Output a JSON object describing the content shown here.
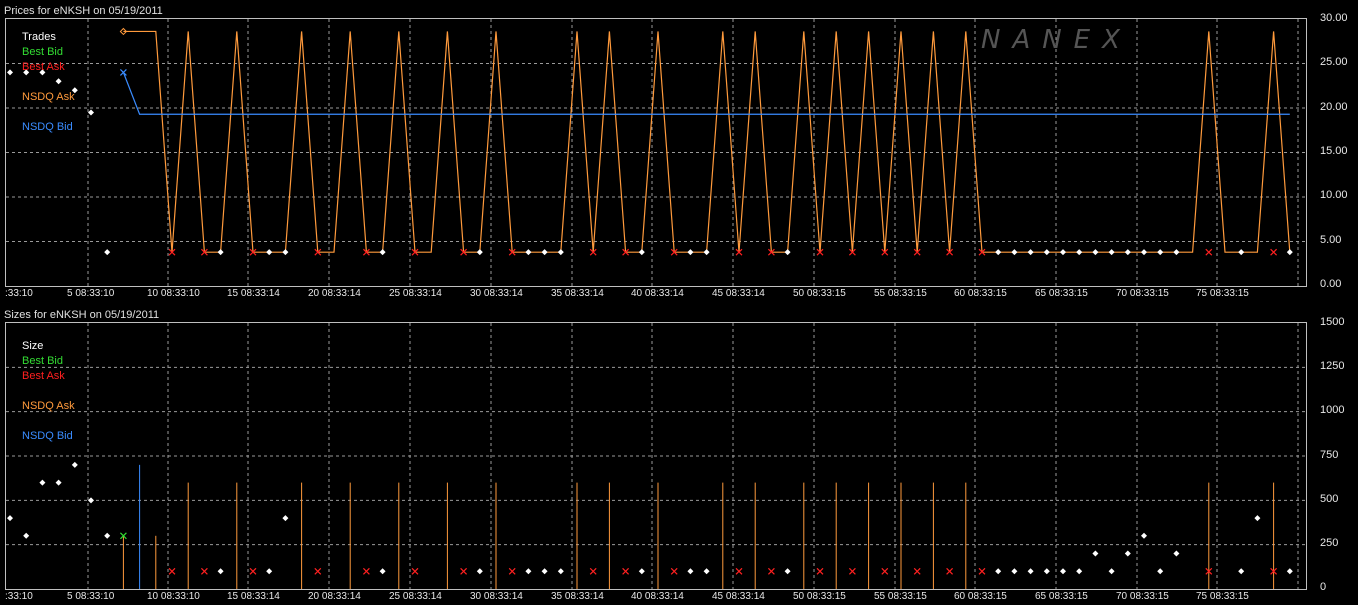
{
  "price_panel": {
    "title": "Prices for  eNKSH  on  05/19/2011",
    "watermark": "NANEX",
    "legend": [
      {
        "label": "Trades",
        "color": "#ffffff"
      },
      {
        "label": "Best Bid",
        "color": "#33dd33"
      },
      {
        "label": "Best Ask",
        "color": "#ff2020"
      },
      {
        "label": "NSDQ Ask",
        "color": "#ff9a3c"
      },
      {
        "label": "NSDQ Bid",
        "color": "#3a8cff"
      }
    ],
    "y_tick_labels": [
      "30.00",
      "25.00",
      "20.00",
      "15.00",
      "10.00",
      "5.00",
      "0.00"
    ]
  },
  "size_panel": {
    "title": "Sizes for  eNKSH  on  05/19/2011",
    "legend": [
      {
        "label": "Size",
        "color": "#ffffff"
      },
      {
        "label": "Best Bid",
        "color": "#33dd33"
      },
      {
        "label": "Best Ask",
        "color": "#ff2020"
      },
      {
        "label": "NSDQ Ask",
        "color": "#ff9a3c"
      },
      {
        "label": "NSDQ Bid",
        "color": "#3a8cff"
      }
    ],
    "y_tick_labels": [
      "1500",
      "1250",
      "1000",
      "750",
      "500",
      "250",
      "0"
    ]
  },
  "x_tick_labels": [
    ":33:10",
    "5 08:33:10",
    "10 08:33:10",
    "15 08:33:14",
    "20 08:33:14",
    "25 08:33:14",
    "30 08:33:14",
    "35 08:33:14",
    "40 08:33:14",
    "45 08:33:14",
    "50 08:33:15",
    "55 08:33:15",
    "60 08:33:15",
    "65 08:33:15",
    "70 08:33:15",
    "75 08:33:15"
  ],
  "chart_data": [
    {
      "type": "line",
      "title": "Prices for  eNKSH  on  05/19/2011",
      "ylim": [
        0,
        30
      ],
      "xlim": [
        0,
        80.5
      ],
      "grid": true,
      "legend_position": "top-left",
      "trades": [
        [
          0,
          24.0
        ],
        [
          1,
          24.0
        ],
        [
          2,
          24.0
        ],
        [
          3,
          23.0
        ],
        [
          4,
          22.0
        ],
        [
          5,
          19.5
        ],
        [
          6,
          3.8
        ],
        [
          13,
          3.8
        ],
        [
          16,
          3.8
        ],
        [
          17,
          3.8
        ],
        [
          23,
          3.8
        ],
        [
          29,
          3.8
        ],
        [
          32,
          3.8
        ],
        [
          33,
          3.8
        ],
        [
          34,
          3.8
        ],
        [
          39,
          3.8
        ],
        [
          42,
          3.8
        ],
        [
          43,
          3.8
        ],
        [
          48,
          3.8
        ],
        [
          61,
          3.8
        ],
        [
          62,
          3.8
        ],
        [
          63,
          3.8
        ],
        [
          64,
          3.8
        ],
        [
          65,
          3.8
        ],
        [
          66,
          3.8
        ],
        [
          67,
          3.8
        ],
        [
          68,
          3.8
        ],
        [
          69,
          3.8
        ],
        [
          70,
          3.8
        ],
        [
          71,
          3.8
        ],
        [
          72,
          3.8
        ],
        [
          76,
          3.8
        ],
        [
          79,
          3.8
        ]
      ],
      "best_ask_points": [
        [
          10,
          3.8
        ],
        [
          12,
          3.8
        ],
        [
          15,
          3.8
        ],
        [
          19,
          3.8
        ],
        [
          22,
          3.8
        ],
        [
          25,
          3.8
        ],
        [
          28,
          3.8
        ],
        [
          31,
          3.8
        ],
        [
          36,
          3.8
        ],
        [
          38,
          3.8
        ],
        [
          41,
          3.8
        ],
        [
          45,
          3.8
        ],
        [
          47,
          3.8
        ],
        [
          50,
          3.8
        ],
        [
          52,
          3.8
        ],
        [
          54,
          3.8
        ],
        [
          56,
          3.8
        ],
        [
          58,
          3.8
        ],
        [
          60,
          3.8
        ],
        [
          74,
          3.8
        ],
        [
          78,
          3.8
        ]
      ],
      "nsdq_ask": [
        [
          7,
          28.6
        ],
        [
          9,
          28.6
        ],
        [
          10,
          3.8
        ],
        [
          11,
          28.6
        ],
        [
          12,
          3.8
        ],
        [
          13,
          3.8
        ],
        [
          14,
          28.6
        ],
        [
          15,
          3.8
        ],
        [
          17,
          3.8
        ],
        [
          18,
          28.6
        ],
        [
          19,
          3.8
        ],
        [
          20,
          3.8
        ],
        [
          21,
          28.6
        ],
        [
          22,
          3.8
        ],
        [
          23,
          3.8
        ],
        [
          24,
          28.6
        ],
        [
          25,
          3.8
        ],
        [
          26,
          3.8
        ],
        [
          27,
          28.6
        ],
        [
          28,
          3.8
        ],
        [
          29,
          3.8
        ],
        [
          30,
          28.6
        ],
        [
          31,
          3.8
        ],
        [
          34,
          3.8
        ],
        [
          35,
          28.6
        ],
        [
          36,
          3.8
        ],
        [
          37,
          28.6
        ],
        [
          38,
          3.8
        ],
        [
          39,
          3.8
        ],
        [
          40,
          28.6
        ],
        [
          41,
          3.8
        ],
        [
          43,
          3.8
        ],
        [
          44,
          28.6
        ],
        [
          45,
          3.8
        ],
        [
          46,
          28.6
        ],
        [
          47,
          3.8
        ],
        [
          48,
          3.8
        ],
        [
          49,
          28.6
        ],
        [
          50,
          3.8
        ],
        [
          51,
          28.6
        ],
        [
          52,
          3.8
        ],
        [
          53,
          28.6
        ],
        [
          54,
          3.8
        ],
        [
          55,
          28.6
        ],
        [
          56,
          3.8
        ],
        [
          57,
          28.6
        ],
        [
          58,
          3.8
        ],
        [
          59,
          28.6
        ],
        [
          60,
          3.8
        ],
        [
          73,
          3.8
        ],
        [
          74,
          28.6
        ],
        [
          75,
          3.8
        ],
        [
          77,
          3.8
        ],
        [
          78,
          28.6
        ],
        [
          79,
          3.8
        ]
      ],
      "nsdq_bid": [
        [
          7,
          24.0
        ],
        [
          8,
          19.3
        ],
        [
          79,
          19.3
        ]
      ],
      "best_bid_points": []
    },
    {
      "type": "bar",
      "title": "Sizes for  eNKSH  on  05/19/2011",
      "ylim": [
        0,
        1500
      ],
      "xlim": [
        0,
        80.5
      ],
      "grid": true,
      "legend_position": "top-left",
      "trade_sizes": [
        [
          0,
          400
        ],
        [
          1,
          300
        ],
        [
          2,
          600
        ],
        [
          3,
          600
        ],
        [
          4,
          700
        ],
        [
          5,
          500
        ],
        [
          6,
          300
        ],
        [
          13,
          100
        ],
        [
          16,
          100
        ],
        [
          17,
          400
        ],
        [
          23,
          100
        ],
        [
          29,
          100
        ],
        [
          32,
          100
        ],
        [
          33,
          100
        ],
        [
          34,
          100
        ],
        [
          39,
          100
        ],
        [
          42,
          100
        ],
        [
          43,
          100
        ],
        [
          48,
          100
        ],
        [
          61,
          100
        ],
        [
          62,
          100
        ],
        [
          63,
          100
        ],
        [
          64,
          100
        ],
        [
          65,
          100
        ],
        [
          66,
          100
        ],
        [
          67,
          200
        ],
        [
          68,
          100
        ],
        [
          69,
          200
        ],
        [
          70,
          300
        ],
        [
          71,
          100
        ],
        [
          72,
          200
        ],
        [
          76,
          100
        ],
        [
          77,
          400
        ],
        [
          79,
          100
        ]
      ],
      "best_ask_sizes": [
        [
          10,
          100
        ],
        [
          12,
          100
        ],
        [
          15,
          100
        ],
        [
          19,
          100
        ],
        [
          22,
          100
        ],
        [
          25,
          100
        ],
        [
          28,
          100
        ],
        [
          31,
          100
        ],
        [
          36,
          100
        ],
        [
          38,
          100
        ],
        [
          41,
          100
        ],
        [
          45,
          100
        ],
        [
          47,
          100
        ],
        [
          50,
          100
        ],
        [
          52,
          100
        ],
        [
          54,
          100
        ],
        [
          56,
          100
        ],
        [
          58,
          100
        ],
        [
          60,
          100
        ],
        [
          74,
          100
        ],
        [
          78,
          100
        ]
      ],
      "best_bid_sizes": [
        [
          7,
          300
        ]
      ],
      "nsdq_ask_sizes": [
        [
          7,
          300
        ],
        [
          9,
          300
        ],
        [
          11,
          600
        ],
        [
          14,
          600
        ],
        [
          18,
          600
        ],
        [
          21,
          600
        ],
        [
          24,
          600
        ],
        [
          27,
          600
        ],
        [
          30,
          600
        ],
        [
          35,
          600
        ],
        [
          37,
          600
        ],
        [
          40,
          600
        ],
        [
          44,
          600
        ],
        [
          46,
          600
        ],
        [
          49,
          600
        ],
        [
          51,
          600
        ],
        [
          53,
          600
        ],
        [
          55,
          600
        ],
        [
          57,
          600
        ],
        [
          59,
          600
        ],
        [
          74,
          600
        ],
        [
          78,
          600
        ]
      ],
      "nsdq_bid_sizes": [
        [
          8,
          700
        ]
      ]
    }
  ]
}
